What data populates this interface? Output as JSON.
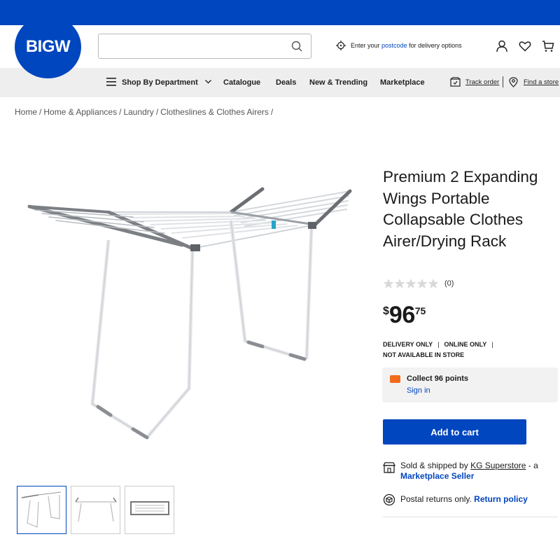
{
  "brand": {
    "logo_text": "BIGW",
    "primary_color": "#0046be",
    "accent_orange": "#f26b1d"
  },
  "header": {
    "search": {
      "value": "",
      "placeholder": ""
    },
    "postcode": {
      "prefix": "Enter your",
      "link": "postcode",
      "suffix": "for delivery options"
    },
    "icons": [
      "account-icon",
      "heart-icon",
      "cart-icon"
    ]
  },
  "nav": {
    "shop_by_department": "Shop By Department",
    "items": [
      "Catalogue",
      "Deals",
      "New & Trending",
      "Marketplace"
    ],
    "track_order": "Track order",
    "find_store": "Find a store"
  },
  "breadcrumb": [
    "Home",
    "Home & Appliances",
    "Laundry",
    "Clotheslines & Clothes Airers"
  ],
  "product": {
    "title": "Premium 2 Expanding Wings Portable Collapsable Clothes Airer/Drying Rack",
    "rating_count": "(0)",
    "rating_value": 0,
    "rating_max": 5,
    "price": {
      "currency": "$",
      "dollars": "96",
      "cents": "75"
    },
    "availability": {
      "delivery": "DELIVERY ONLY",
      "online": "ONLINE ONLY",
      "store": "NOT AVAILABLE IN STORE"
    },
    "points": {
      "text": "Collect 96 points",
      "signin": "Sign in"
    },
    "add_to_cart": "Add to cart",
    "sold_by": {
      "prefix": "Sold & shipped by",
      "seller": "KG Superstore",
      "mid": "- a",
      "marketplace": "Marketplace Seller"
    },
    "returns": {
      "text": "Postal returns only.",
      "link": "Return policy"
    },
    "thumbnails_count": 3,
    "active_thumbnail": 1
  }
}
